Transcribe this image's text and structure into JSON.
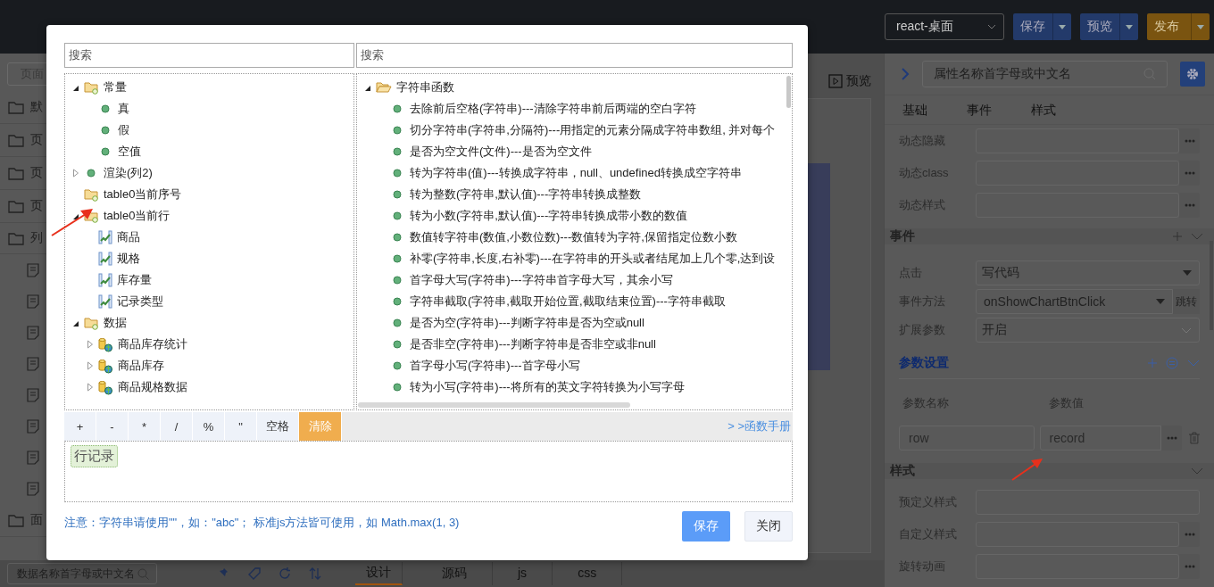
{
  "header": {
    "app_select": "react-桌面",
    "buttons": [
      {
        "label": "保存",
        "kind": "primary"
      },
      {
        "label": "预览",
        "kind": "info"
      },
      {
        "label": "发布",
        "kind": "warning"
      }
    ]
  },
  "sidebar": {
    "search": {
      "placeholder": "页面"
    },
    "items": [
      {
        "kind": "folder",
        "label": "默"
      },
      {
        "kind": "folder",
        "label": "页"
      },
      {
        "kind": "folder",
        "label": "页"
      },
      {
        "kind": "folder",
        "label": "页"
      },
      {
        "kind": "folder",
        "label": "列"
      },
      {
        "kind": "doc"
      },
      {
        "kind": "doc"
      },
      {
        "kind": "doc"
      },
      {
        "kind": "doc"
      },
      {
        "kind": "doc"
      },
      {
        "kind": "doc"
      },
      {
        "kind": "doc"
      },
      {
        "kind": "doc"
      },
      {
        "kind": "folder",
        "label": "面"
      }
    ]
  },
  "canvas": {
    "preview_button": "预览"
  },
  "bottom_bar": {
    "search": {
      "placeholder": "数据名称首字母或中文名"
    },
    "tabs": [
      {
        "label": "设计",
        "selected": true
      },
      {
        "label": "源码",
        "selected": false
      },
      {
        "label": "js",
        "selected": false
      },
      {
        "label": "css",
        "selected": false
      }
    ]
  },
  "property_panel": {
    "search": {
      "placeholder": "属性名称首字母或中文名"
    },
    "tabs": [
      {
        "label": "基础"
      },
      {
        "label": "事件"
      },
      {
        "label": "样式"
      }
    ],
    "rows": [
      {
        "label": "动态隐藏",
        "kind": "input_more"
      },
      {
        "label": "动态class",
        "kind": "input_more"
      },
      {
        "label": "动态样式",
        "kind": "input_more"
      }
    ],
    "event_section": {
      "title": "事件",
      "rows": [
        {
          "label": "点击",
          "kind": "select",
          "value": "写代码"
        },
        {
          "label": "事件方法",
          "kind": "select_jump",
          "value": "onShowChartBtnClick",
          "button": "跳转"
        },
        {
          "label": "扩展参数",
          "kind": "dropdown",
          "value": "开启"
        }
      ],
      "params": {
        "title": "参数设置",
        "columns": [
          "参数名称",
          "参数值"
        ],
        "rows": [
          {
            "name": "row",
            "value": "record"
          }
        ]
      }
    },
    "style_section": {
      "title": "样式",
      "rows": [
        {
          "label": "预定义样式",
          "kind": "input"
        },
        {
          "label": "自定义样式",
          "kind": "input_more"
        },
        {
          "label": "旋转动画",
          "kind": "input_more"
        }
      ]
    }
  },
  "dialog": {
    "left_search": {
      "placeholder": "搜索"
    },
    "right_search": {
      "placeholder": "搜索"
    },
    "variable_tree": [
      {
        "label": "常量",
        "kind": "folder",
        "expanded": true,
        "children": [
          {
            "label": "真",
            "kind": "dot"
          },
          {
            "label": "假",
            "kind": "dot"
          },
          {
            "label": "空值",
            "kind": "dot"
          }
        ]
      },
      {
        "label": "渲染(列2)",
        "kind": "dot",
        "expanded": false
      },
      {
        "label": "table0当前序号",
        "kind": "folder"
      },
      {
        "label": "table0当前行",
        "kind": "folder",
        "expanded": true,
        "children": [
          {
            "label": "商品",
            "kind": "field"
          },
          {
            "label": "规格",
            "kind": "field"
          },
          {
            "label": "库存量",
            "kind": "field"
          },
          {
            "label": "记录类型",
            "kind": "field"
          }
        ]
      },
      {
        "label": "数据",
        "kind": "folder",
        "expanded": true,
        "children": [
          {
            "label": "商品库存统计",
            "kind": "database",
            "expanded": false
          },
          {
            "label": "商品库存",
            "kind": "database",
            "expanded": false
          },
          {
            "label": "商品规格数据",
            "kind": "database",
            "expanded": false
          }
        ]
      }
    ],
    "function_tree": [
      {
        "label": "字符串函数",
        "kind": "open_folder",
        "expanded": true,
        "children": [
          {
            "label": "去除前后空格(字符串)---清除字符串前后两端的空白字符",
            "kind": "dot"
          },
          {
            "label": "切分字符串(字符串,分隔符)---用指定的元素分隔成字符串数组, 并对每个",
            "kind": "dot"
          },
          {
            "label": "是否为空文件(文件)---是否为空文件",
            "kind": "dot"
          },
          {
            "label": "转为字符串(值)---转换成字符串，null、undefined转换成空字符串",
            "kind": "dot"
          },
          {
            "label": "转为整数(字符串,默认值)---字符串转换成整数",
            "kind": "dot"
          },
          {
            "label": "转为小数(字符串,默认值)---字符串转换成带小数的数值",
            "kind": "dot"
          },
          {
            "label": "数值转字符串(数值,小数位数)---数值转为字符,保留指定位数小数",
            "kind": "dot"
          },
          {
            "label": "补零(字符串,长度,右补零)---在字符串的开头或者结尾加上几个零,达到设",
            "kind": "dot"
          },
          {
            "label": "首字母大写(字符串)---字符串首字母大写，其余小写",
            "kind": "dot"
          },
          {
            "label": "字符串截取(字符串,截取开始位置,截取结束位置)---字符串截取",
            "kind": "dot"
          },
          {
            "label": "是否为空(字符串)---判断字符串是否为空或null",
            "kind": "dot"
          },
          {
            "label": "是否非空(字符串)---判断字符串是否非空或非null",
            "kind": "dot"
          },
          {
            "label": "首字母小写(字符串)---首字母小写",
            "kind": "dot"
          },
          {
            "label": "转为小写(字符串)---将所有的英文字符转换为小写字母",
            "kind": "dot"
          }
        ]
      }
    ],
    "operators": [
      {
        "label": "+",
        "kind": "operator"
      },
      {
        "label": "-",
        "kind": "operator"
      },
      {
        "label": "*",
        "kind": "operator"
      },
      {
        "label": "/",
        "kind": "operator"
      },
      {
        "label": "%",
        "kind": "operator"
      },
      {
        "label": "\"",
        "kind": "operator"
      },
      {
        "label": "空格",
        "kind": "operator"
      },
      {
        "label": "清除",
        "kind": "clear"
      }
    ],
    "manual_link": "> >函数手册",
    "expression_tokens": [
      "行记录"
    ],
    "note": "注意：字符串请使用\"\"，如：\"abc\"； 标准js方法皆可使用，如 Math.max(1, 3)",
    "buttons": [
      {
        "label": "保存",
        "kind": "primary"
      },
      {
        "label": "关闭",
        "kind": "default"
      }
    ]
  }
}
